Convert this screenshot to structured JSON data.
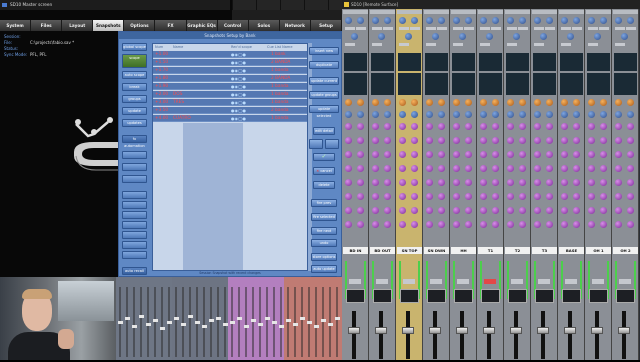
{
  "left_window": {
    "title": "SD10 Master screen",
    "toolbar_buttons": [
      "",
      "",
      "",
      "",
      ""
    ]
  },
  "nav_tabs": [
    "System",
    "Files",
    "Layout",
    "Snapshots",
    "Options",
    "FX",
    "Graphic EQs",
    "Control Groups",
    "Solos",
    "Network",
    "Setup"
  ],
  "session": {
    "labels": [
      "Session:",
      "File:",
      "Status:",
      "Sync Mode:"
    ],
    "values": [
      "",
      "C:\\projects\\fabio.sav *",
      "",
      "PFL, PFL"
    ]
  },
  "snapshots_dialog": {
    "title": "Snapshots Setup by Bank",
    "left_buttons": [
      "global scope",
      "scope",
      "auto scope",
      "break",
      "groups",
      "update",
      "updates",
      "fx automation",
      "",
      "",
      "",
      "",
      "",
      "",
      "",
      "",
      "",
      "",
      "",
      "",
      "",
      "",
      "",
      "auto recall"
    ],
    "columns": [
      "Num",
      "Name",
      "Rec'd scope",
      "Cue List Name"
    ],
    "rows": [
      {
        "num": "+1.00",
        "name": "",
        "cue": "1 bank"
      },
      {
        "num": "+1.50",
        "name": "",
        "cue": "2 BANDA"
      },
      {
        "num": "+1.70",
        "name": "",
        "cue": "1 banda"
      },
      {
        "num": "+1.80",
        "name": "",
        "cue": "2 BANDA"
      },
      {
        "num": "+1.90",
        "name": "",
        "cue": "1 banda"
      },
      {
        "num": "+2.00",
        "name": "DOS",
        "cue": "1 banda"
      },
      {
        "num": "+3.00",
        "name": "TRES",
        "cue": "1 banda"
      },
      {
        "num": "+3.50",
        "name": "",
        "cue": "2 banda"
      },
      {
        "num": "+4.00",
        "name": "CUATRO",
        "cue": "1 banda"
      }
    ],
    "right_buttons": [
      "insert new",
      "duplicate",
      "update current",
      "update groups",
      "update selected",
      "edit detail",
      "",
      "",
      "",
      "cancel",
      "delete",
      "fire prev",
      "fire selected",
      "fire next",
      "undo",
      "store options",
      "auto update",
      "restore groups"
    ],
    "status": "Session Snapshot with recent changes"
  },
  "mixer_window": {
    "title": "SD10 [Remote Surface]"
  },
  "mixer": {
    "channels": [
      "BD IN",
      "BD OUT",
      "SN TOP",
      "SN DWN",
      "HH",
      "T1",
      "T2",
      "T3",
      "BASE",
      "OH 1",
      "OH 2"
    ],
    "selected_index": 2,
    "muted_index": 5
  },
  "mini_faders": {
    "banks": [
      "",
      "",
      "",
      ""
    ]
  },
  "colors": {
    "dialog_bg": "#5f88c4",
    "row_text": "#ff4a4a",
    "strip_selected": "#c9b46e",
    "nav_active": "#e6e6e6"
  }
}
